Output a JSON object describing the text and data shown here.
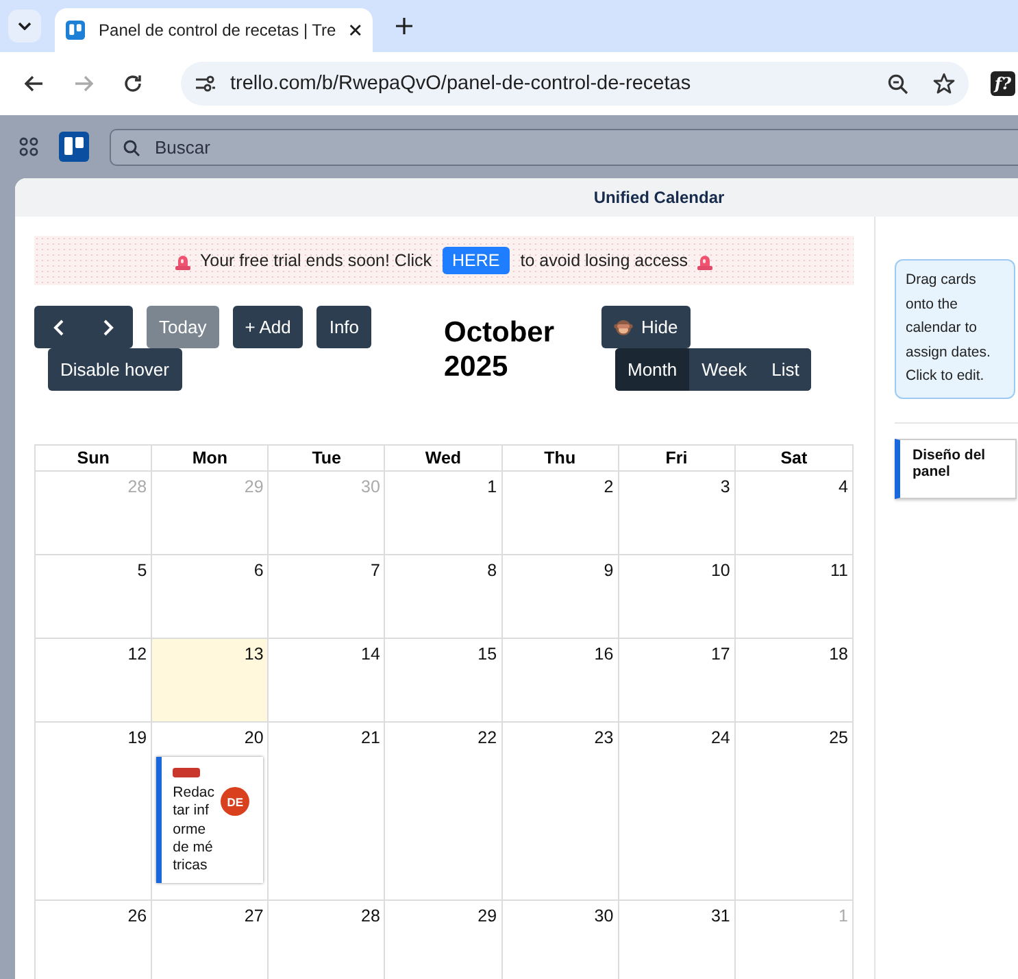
{
  "browser": {
    "tab_title": "Panel de control de recetas | Tre",
    "url": "trello.com/b/RwepaQvO/panel-de-control-de-recetas",
    "extension_label": "f?"
  },
  "app_header": {
    "search_placeholder": "Buscar"
  },
  "modal": {
    "title": "Unified Calendar"
  },
  "banner": {
    "before": "Your free trial ends soon! Click",
    "link": "HERE",
    "after": "to avoid losing access"
  },
  "toolbar": {
    "today": {
      "label": "Today",
      "disabled": true
    },
    "add": "+ Add",
    "info": "Info",
    "disable_hover": "Disable hover",
    "hide": "Hide",
    "month_title": "October 2025",
    "views": [
      {
        "label": "Month",
        "selected": true
      },
      {
        "label": "Week",
        "selected": false
      },
      {
        "label": "List",
        "selected": false
      }
    ]
  },
  "calendar": {
    "weekdays": [
      "Sun",
      "Mon",
      "Tue",
      "Wed",
      "Thu",
      "Fri",
      "Sat"
    ],
    "weeks": [
      {
        "days": [
          {
            "day": "28",
            "in_month": false,
            "today": false
          },
          {
            "day": "29",
            "in_month": false,
            "today": false
          },
          {
            "day": "30",
            "in_month": false,
            "today": false
          },
          {
            "day": "1",
            "in_month": true,
            "today": false
          },
          {
            "day": "2",
            "in_month": true,
            "today": false
          },
          {
            "day": "3",
            "in_month": true,
            "today": false
          },
          {
            "day": "4",
            "in_month": true,
            "today": false
          }
        ]
      },
      {
        "days": [
          {
            "day": "5",
            "in_month": true,
            "today": false
          },
          {
            "day": "6",
            "in_month": true,
            "today": false
          },
          {
            "day": "7",
            "in_month": true,
            "today": false
          },
          {
            "day": "8",
            "in_month": true,
            "today": false
          },
          {
            "day": "9",
            "in_month": true,
            "today": false
          },
          {
            "day": "10",
            "in_month": true,
            "today": false
          },
          {
            "day": "11",
            "in_month": true,
            "today": false
          }
        ]
      },
      {
        "days": [
          {
            "day": "12",
            "in_month": true,
            "today": false
          },
          {
            "day": "13",
            "in_month": true,
            "today": true
          },
          {
            "day": "14",
            "in_month": true,
            "today": false
          },
          {
            "day": "15",
            "in_month": true,
            "today": false
          },
          {
            "day": "16",
            "in_month": true,
            "today": false
          },
          {
            "day": "17",
            "in_month": true,
            "today": false
          },
          {
            "day": "18",
            "in_month": true,
            "today": false
          }
        ]
      },
      {
        "days": [
          {
            "day": "19",
            "in_month": true,
            "today": false
          },
          {
            "day": "20",
            "in_month": true,
            "today": false,
            "events": [
              {
                "title": "Redactar informe de métricas",
                "color": "#c9372c",
                "avatar": "DE"
              }
            ]
          },
          {
            "day": "21",
            "in_month": true,
            "today": false
          },
          {
            "day": "22",
            "in_month": true,
            "today": false
          },
          {
            "day": "23",
            "in_month": true,
            "today": false
          },
          {
            "day": "24",
            "in_month": true,
            "today": false
          },
          {
            "day": "25",
            "in_month": true,
            "today": false
          }
        ]
      },
      {
        "days": [
          {
            "day": "26",
            "in_month": true,
            "today": false
          },
          {
            "day": "27",
            "in_month": true,
            "today": false
          },
          {
            "day": "28",
            "in_month": true,
            "today": false
          },
          {
            "day": "29",
            "in_month": true,
            "today": false
          },
          {
            "day": "30",
            "in_month": true,
            "today": false
          },
          {
            "day": "31",
            "in_month": true,
            "today": false
          },
          {
            "day": "1",
            "in_month": false,
            "today": false
          }
        ]
      }
    ]
  },
  "sidebar": {
    "hint": "Drag cards onto the calendar to assign dates. Click to edit.",
    "cards": [
      {
        "title": "Diseño del panel"
      }
    ]
  }
}
